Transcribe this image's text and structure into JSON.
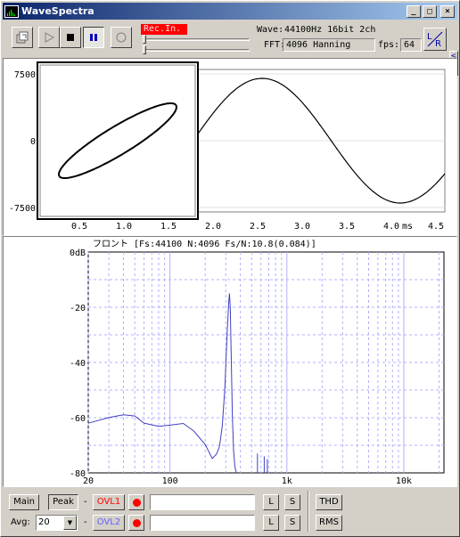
{
  "window": {
    "title": "WaveSpectra"
  },
  "titlebar_buttons": {
    "minimize": "_",
    "maximize": "□",
    "close": "×"
  },
  "toolbar": {
    "rec_in": "Rec.In.",
    "wave_label": "Wave:",
    "wave_value": "44100Hz 16bit 2ch",
    "fft_label": "FFT:",
    "fft_value": "4096 Hanning",
    "fps_label": "fps:",
    "fps_value": "64",
    "lr_label": "LR",
    "icons": [
      "export-icon",
      "play-icon",
      "stop-icon",
      "pause-icon",
      "record-icon"
    ]
  },
  "waveform": {
    "y_ticks": [
      "7500",
      "0",
      "-7500"
    ],
    "x_ticks": [
      "0.5",
      "1.0",
      "1.5",
      "2.0",
      "2.5",
      "3.0",
      "3.5",
      "4.0",
      "4.5"
    ],
    "x_unit": "ms"
  },
  "spectrum": {
    "header": "フロント  [Fs:44100 N:4096 Fs/N:10.8(0.084)]",
    "y_ticks": [
      "0dB",
      "-20",
      "-40",
      "-60",
      "-80"
    ],
    "x_ticks": [
      "20",
      "100",
      "1k",
      "10k"
    ]
  },
  "bottom": {
    "main": "Main",
    "peak": "Peak",
    "dash1": "-",
    "dash2": "-",
    "ovl1": "OVL1",
    "ovl2": "OVL2",
    "l": "L",
    "s": "S",
    "thd": "THD",
    "rms": "RMS",
    "avg_label": "Avg:",
    "avg_value": "20"
  },
  "chart_data": [
    {
      "type": "line",
      "title": "",
      "xlabel": "ms",
      "ylabel": "",
      "xlim": [
        0.1,
        4.6
      ],
      "ylim": [
        -8000,
        8000
      ],
      "series": [
        {
          "values": "sine wave, peak ≈ 7000 at 2.55 ms, trough ≈ -7000 at 4.1 ms"
        }
      ]
    },
    {
      "type": "line",
      "title": "フロント  [Fs:44100 N:4096 Fs/N:10.8(0.084)]",
      "xlabel": "",
      "ylabel": "",
      "xscale": "log",
      "xlim": [
        20,
        22050
      ],
      "ylim": [
        -80,
        0
      ],
      "peak": {
        "x": 323,
        "y": -15
      },
      "color": "#4040c0"
    }
  ]
}
